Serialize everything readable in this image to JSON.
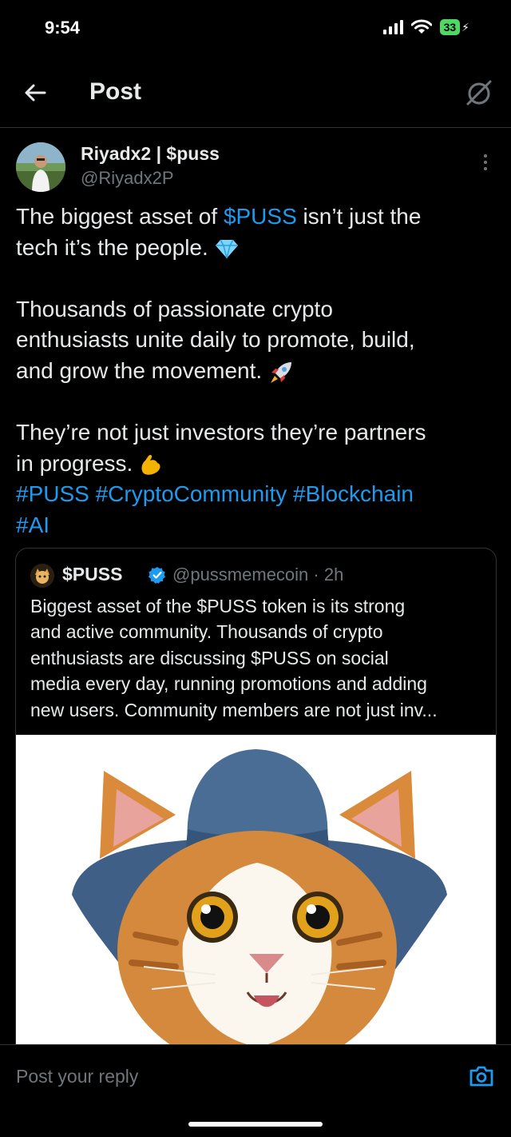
{
  "status": {
    "time": "9:54",
    "battery": "33"
  },
  "header": {
    "title": "Post"
  },
  "post": {
    "display_name": "Riyadx2 | $puss",
    "handle": "@Riyadx2P",
    "line1_a": "The biggest asset of ",
    "line1_link": "$PUSS",
    "line1_b": " isn’t just the",
    "line2": "tech  it’s the people. ",
    "line3": "Thousands of passionate crypto",
    "line4": "enthusiasts unite daily to promote, build,",
    "line5": "and grow the movement. ",
    "line6": "They’re not just investors  they’re partners",
    "line7": "in progress. ",
    "hashtags_line1": "#PUSS #CryptoCommunity #Blockchain",
    "hashtags_line2": "#AI"
  },
  "quote": {
    "name": "$PUSS",
    "handle_time": "@pussmemecoin · 2h",
    "lines": [
      "Biggest asset of the $PUSS token is its strong",
      "and active community. Thousands of crypto",
      "enthusiasts are discussing $PUSS on social",
      "media every day, running promotions and adding",
      "new users. Community members are not just inv..."
    ]
  },
  "reply": {
    "placeholder": "Post your reply"
  },
  "icons": {
    "back": "arrow-left-icon",
    "grok": "grok-icon",
    "more": "more-vertical-icon",
    "verified": "verified-badge-icon",
    "camera": "camera-icon"
  },
  "colors": {
    "link": "#1d9bf0",
    "background": "#000000",
    "muted": "#71767b",
    "battery": "#4cd964"
  }
}
